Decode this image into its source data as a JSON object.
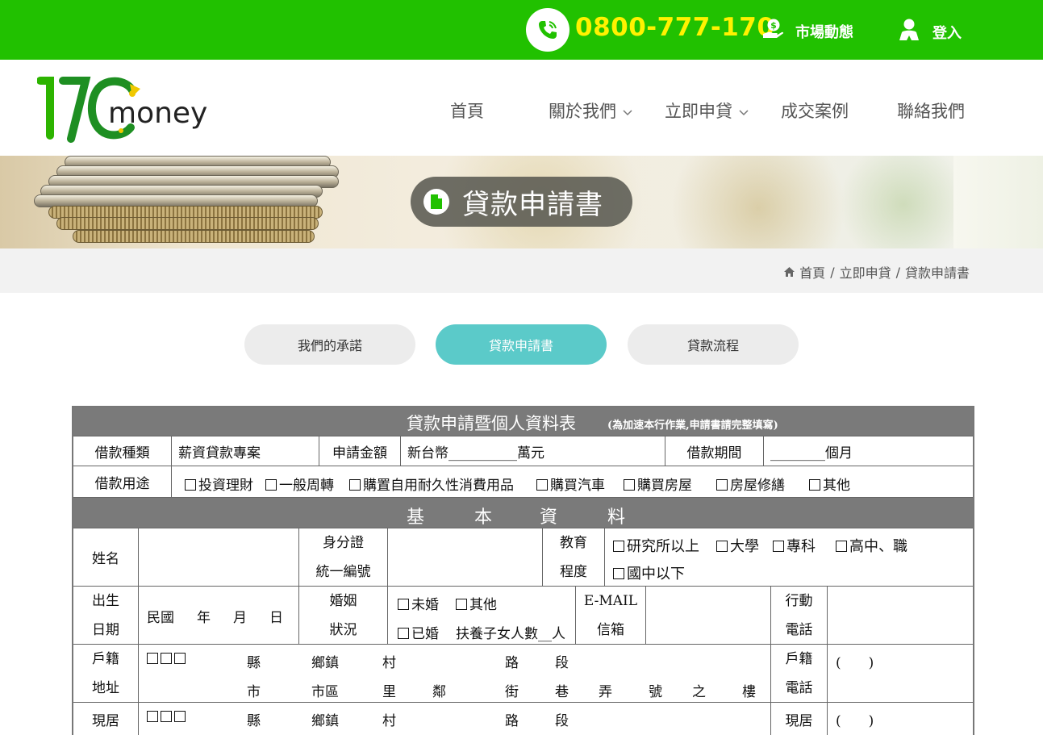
{
  "topbar": {
    "phone": "0800-777-170",
    "market_link": "市場動態",
    "login_link": "登入"
  },
  "logo": {
    "number": "170",
    "word": "money"
  },
  "nav": {
    "home": "首頁",
    "about": "關於我們",
    "apply": "立即申貸",
    "cases": "成交案例",
    "contact": "聯絡我們"
  },
  "banner": {
    "title": "貸款申請書"
  },
  "breadcrumb": {
    "home": "首頁",
    "sep": "/",
    "level1": "立即申貸",
    "current": "貸款申請書"
  },
  "tabs": [
    "我們的承諾",
    "貸款申請書",
    "貸款流程"
  ],
  "form": {
    "title": "貸款申請暨個人資料表",
    "title_note": "(為加速本行作業,申請書請完整填寫)",
    "loan_type_label": "借款種類",
    "loan_type_value": "薪資貸款專案",
    "amount_label": "申請金額",
    "amount_value": "新台幣__________萬元",
    "period_label": "借款期間",
    "period_value": "________個月",
    "purpose_label": "借款用途",
    "purpose_options": [
      "投資理財",
      "一般周轉",
      "購置自用耐久性消費用品",
      "購買汽車",
      "購買房屋",
      "房屋修繕",
      "其他"
    ],
    "section_basic": [
      "基",
      "本",
      "資",
      "料"
    ],
    "name_label": "姓名",
    "id_label_1": "身分證",
    "id_label_2": "統一編號",
    "edu_label_1": "教育",
    "edu_label_2": "程度",
    "edu_options": [
      "研究所以上",
      "大學",
      "專科",
      "高中、職",
      "國中以下"
    ],
    "birth_label_1": "出生",
    "birth_label_2": "日期",
    "birth_value": [
      "民國",
      "年",
      "月",
      "日"
    ],
    "marital_label_1": "婚姻",
    "marital_label_2": "狀況",
    "marital_unmarried": "未婚",
    "marital_other": "其他",
    "marital_married": "已婚",
    "marital_children": "扶養子女人數__人",
    "email_label_1": "E-MAIL",
    "email_label_2": "信箱",
    "mobile_label_1": "行動",
    "mobile_label_2": "電話",
    "reg_label_1": "戶籍",
    "reg_label_2": "地址",
    "addr_line1": [
      "縣",
      "鄉鎮",
      "村",
      "路",
      "段"
    ],
    "addr_line2": [
      "市",
      "市區",
      "里",
      "鄰",
      "街",
      "巷",
      "弄",
      "號",
      "之",
      "樓"
    ],
    "reg_phone_label_1": "戶籍",
    "reg_phone_label_2": "電話",
    "phone_paren": "(　　)",
    "current_label": "現居",
    "current_phone_label": "現居"
  },
  "colors": {
    "topbar": "#21c100",
    "phone_text": "#fff200",
    "active_tab": "#5bcac9",
    "form_header": "#7a7a7a"
  }
}
